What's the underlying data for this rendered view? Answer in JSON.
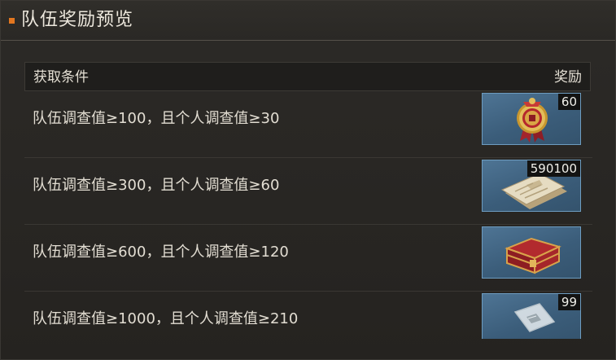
{
  "window": {
    "title": "队伍奖励预览"
  },
  "header": {
    "condition_label": "获取条件",
    "reward_label": "奖励"
  },
  "rows": [
    {
      "condition": "队伍调查值≥100，且个人调查值≥30",
      "reward_icon": "badge-icon",
      "reward_count": "60"
    },
    {
      "condition": "队伍调查值≥300，且个人调查值≥60",
      "reward_icon": "documents-icon",
      "reward_count": "590100"
    },
    {
      "condition": "队伍调查值≥600，且个人调查值≥120",
      "reward_icon": "chest-icon",
      "reward_count": ""
    },
    {
      "condition": "队伍调查值≥1000，且个人调查值≥210",
      "reward_icon": "packet-icon",
      "reward_count": "99"
    }
  ],
  "colors": {
    "accent": "#e2761f",
    "reward_border": "#6d9cc0",
    "reward_bg": "#3b5d7a"
  }
}
